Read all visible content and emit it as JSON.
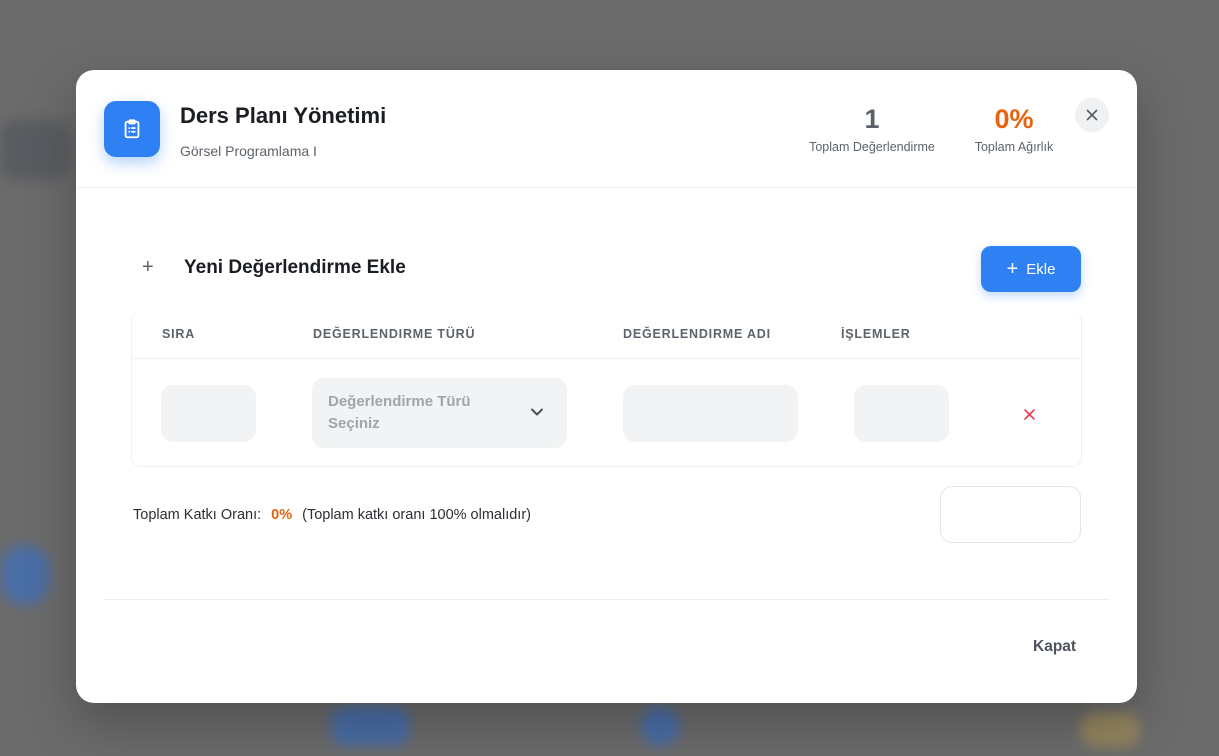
{
  "header": {
    "title": "Ders Planı Yönetimi",
    "subtitle": "Görsel Programlama I",
    "icon": "clipboard-icon",
    "stats": {
      "total_value": "1",
      "total_label": "Toplam Değerlendirme",
      "weight_value": "0%",
      "weight_label": "Toplam Ağırlık"
    },
    "close_icon": "close-icon"
  },
  "section": {
    "plus_glyph": "+",
    "title": "Yeni Değerlendirme Ekle",
    "add_button_plus": "+",
    "add_button_label": "Ekle"
  },
  "table": {
    "columns": [
      "SIRA",
      "DEĞERLENDIRME TÜRÜ",
      "DEĞERLENDIRME ADI",
      "İŞLEMLER"
    ],
    "rows": [
      {
        "sira": "",
        "type_placeholder": "Değerlendirme Türü Seçiniz",
        "ad": "",
        "islem": ""
      }
    ]
  },
  "totals": {
    "label": "Toplam Katkı Oranı:",
    "value": "0%",
    "note": "(Toplam katkı oranı 100% olmalıdır)"
  },
  "footer": {
    "close_label": "Kapat"
  },
  "colors": {
    "accent": "#2f80f2",
    "orange": "#e8620f",
    "danger": "#e0424b",
    "overlay": "#6b6b6b"
  }
}
